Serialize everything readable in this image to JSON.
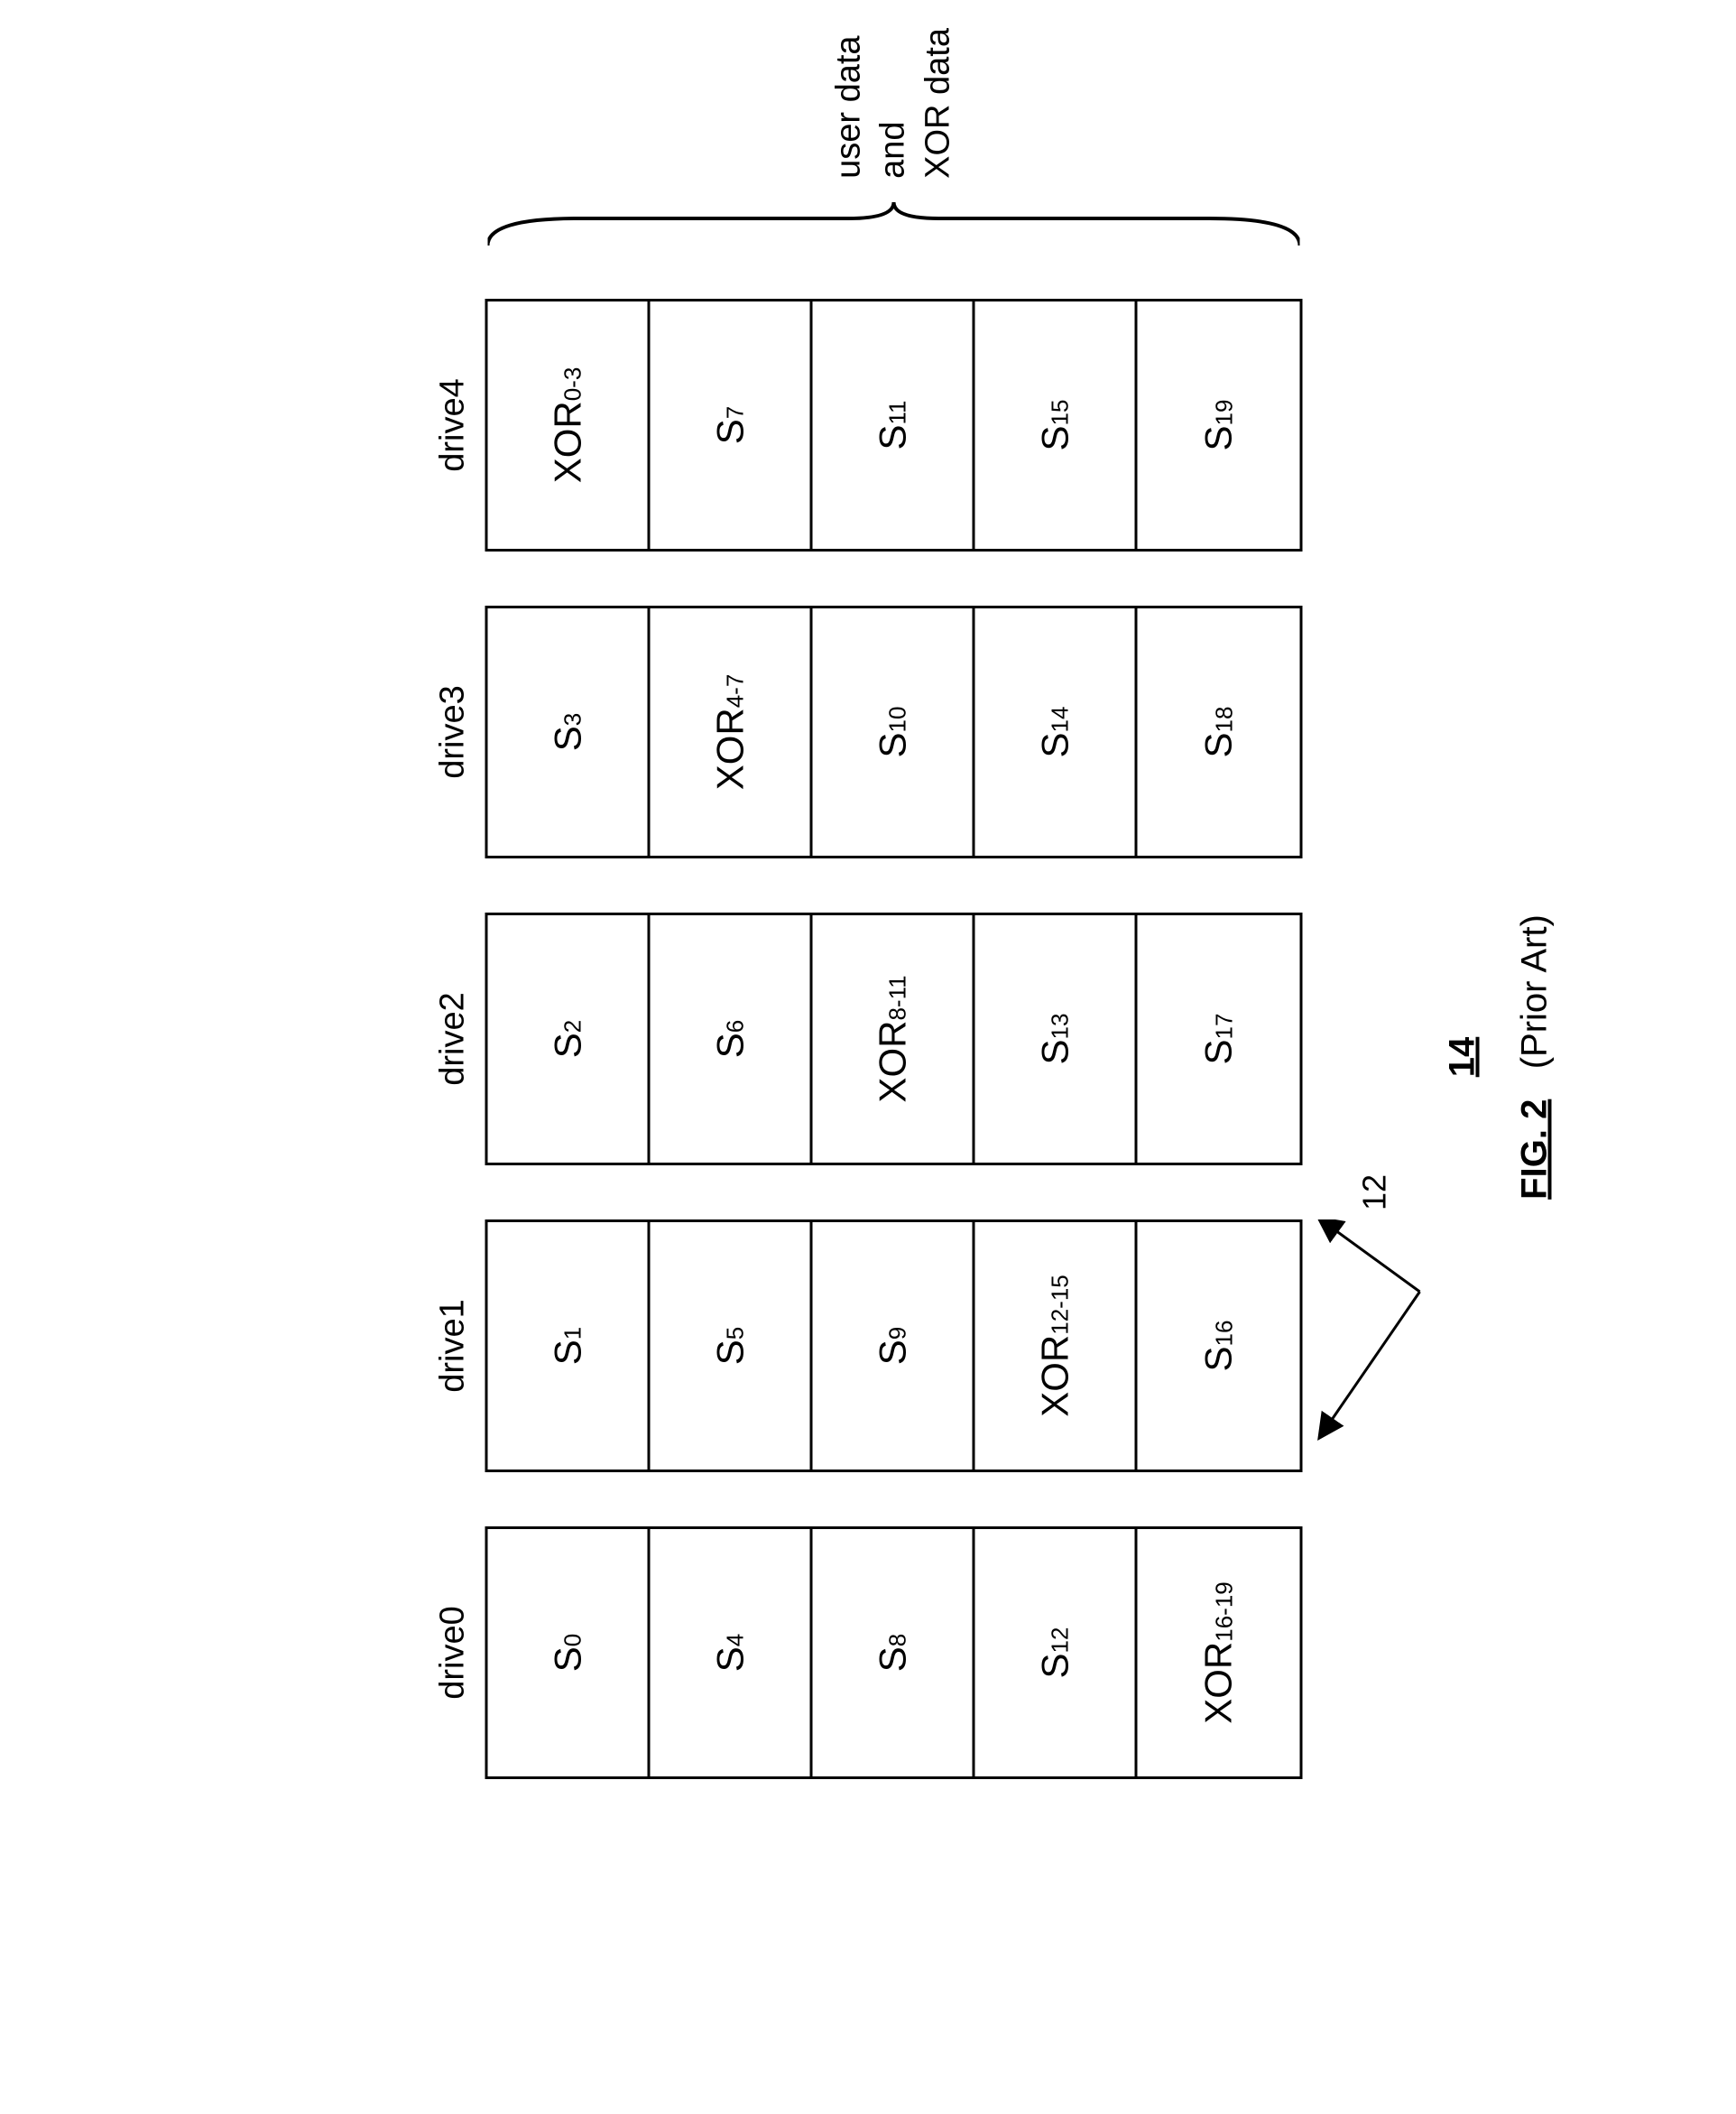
{
  "drives": [
    {
      "header": "drive0",
      "cells": [
        "S|0",
        "S|4",
        "S|8",
        "S|12",
        "XOR|16-19"
      ]
    },
    {
      "header": "drive1",
      "cells": [
        "S|1",
        "S|5",
        "S|9",
        "XOR|12-15",
        "S|16"
      ]
    },
    {
      "header": "drive2",
      "cells": [
        "S|2",
        "S|6",
        "XOR|8-11",
        "S|13",
        "S|17"
      ]
    },
    {
      "header": "drive3",
      "cells": [
        "S|3",
        "XOR|4-7",
        "S|10",
        "S|14",
        "S|18"
      ]
    },
    {
      "header": "drive4",
      "cells": [
        "XOR|0-3",
        "S|7",
        "S|11",
        "S|15",
        "S|19"
      ]
    }
  ],
  "brace_label_line1": "user data",
  "brace_label_line2": "and",
  "brace_label_line3": "XOR data",
  "ref_drives": "12",
  "ref_figure": "14",
  "figure_caption_label": "FIG. 2",
  "figure_caption_note": "(Prior Art)"
}
